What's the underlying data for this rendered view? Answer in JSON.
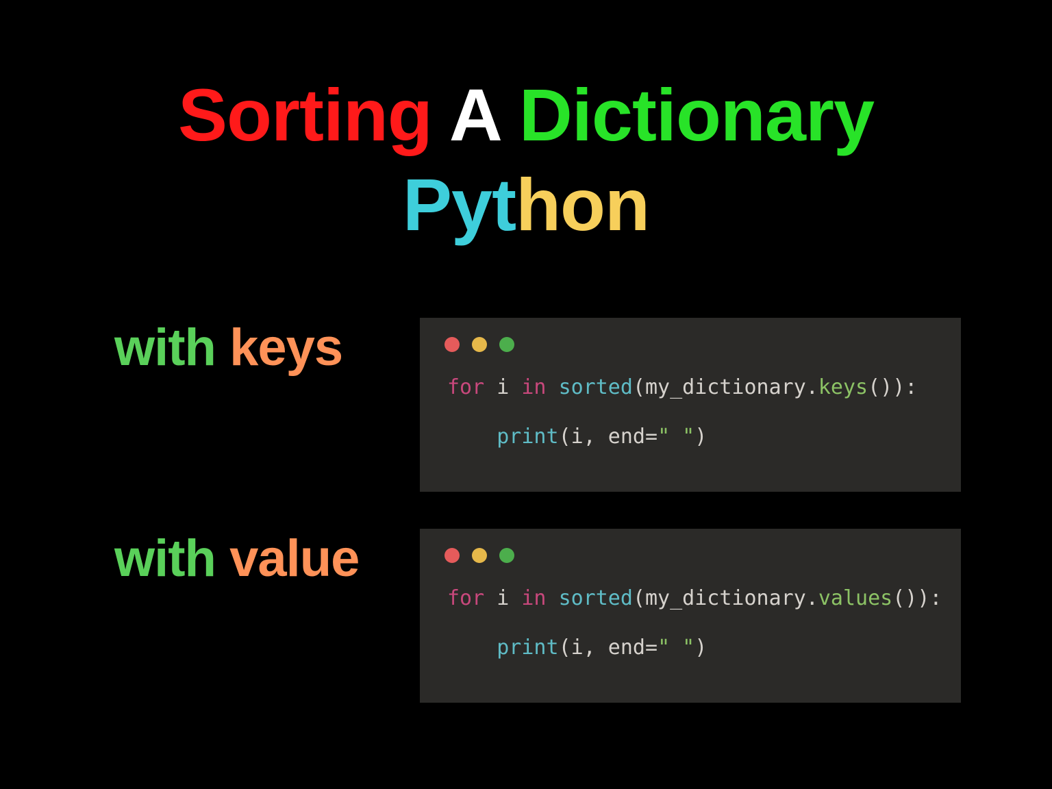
{
  "title": {
    "line1": {
      "w1": "Sorting",
      "w2": "A",
      "w3": "Dictionary"
    },
    "line2": {
      "p1": "Pyt",
      "p2": "hon"
    }
  },
  "rows": [
    {
      "label": {
        "w1": "with",
        "w2": "keys"
      },
      "code": {
        "kw_for": "for",
        "var": " i ",
        "kw_in": "in",
        "sp": " ",
        "fn_sorted": "sorted",
        "open": "(my_dictionary.",
        "attr": "keys",
        "close": "()):",
        "indent": "    ",
        "fn_print": "print",
        "args_open": "(i, end=",
        "str": "\" \"",
        "args_close": ")"
      }
    },
    {
      "label": {
        "w1": "with",
        "w2": "value"
      },
      "code": {
        "kw_for": "for",
        "var": " i ",
        "kw_in": "in",
        "sp": " ",
        "fn_sorted": "sorted",
        "open": "(my_dictionary.",
        "attr": "values",
        "close": "()):",
        "indent": "    ",
        "fn_print": "print",
        "args_open": "(i, end=",
        "str": "\" \"",
        "args_close": ")"
      }
    }
  ]
}
